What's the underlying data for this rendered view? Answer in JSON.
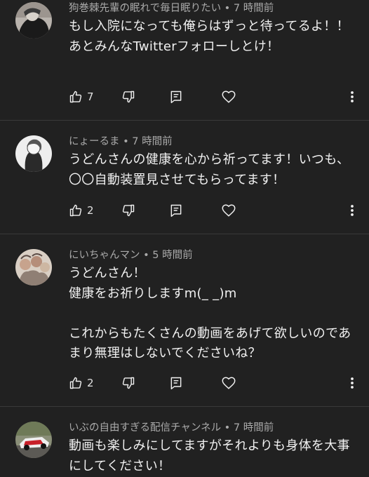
{
  "comments": [
    {
      "author": "狗巻棘先輩の眠れで毎日眠りたい",
      "time": "7 時間前",
      "text": "もし入院になっても俺らはずっと待ってるよ！！\nあとみんなTwitterフォローしとけ！",
      "likes": "7",
      "avatar": "avatar-dark-character"
    },
    {
      "author": "にょーるま",
      "time": "7 時間前",
      "text": "うどんさんの健康を心から祈ってます！いつも、〇〇自動装置見させてもらってます！",
      "likes": "2",
      "avatar": "avatar-sketch-portrait"
    },
    {
      "author": "にいちゃんマン",
      "time": "5 時間前",
      "text": "うどんさん！\n健康をお祈りしますm(_ _)m\n\nこれからもたくさんの動画をあげて欲しいのであまり無理はしないでくださいね？",
      "likes": "2",
      "avatar": "avatar-pastel-group"
    },
    {
      "author": "いぶの自由すぎる配信チャンネル",
      "time": "7 時間前",
      "text": "動画も楽しみにしてますがそれよりも身体を大事にしてください！",
      "likes": "",
      "avatar": "avatar-race-car"
    }
  ],
  "separator": " • ",
  "colors": {
    "background": "#212121",
    "text": "#f1f1f1",
    "meta": "#aaaaaa",
    "divider": "#3a3a3a"
  },
  "icons": [
    "thumb-up-icon",
    "thumb-down-icon",
    "reply-icon",
    "heart-icon",
    "more-vert-icon"
  ]
}
